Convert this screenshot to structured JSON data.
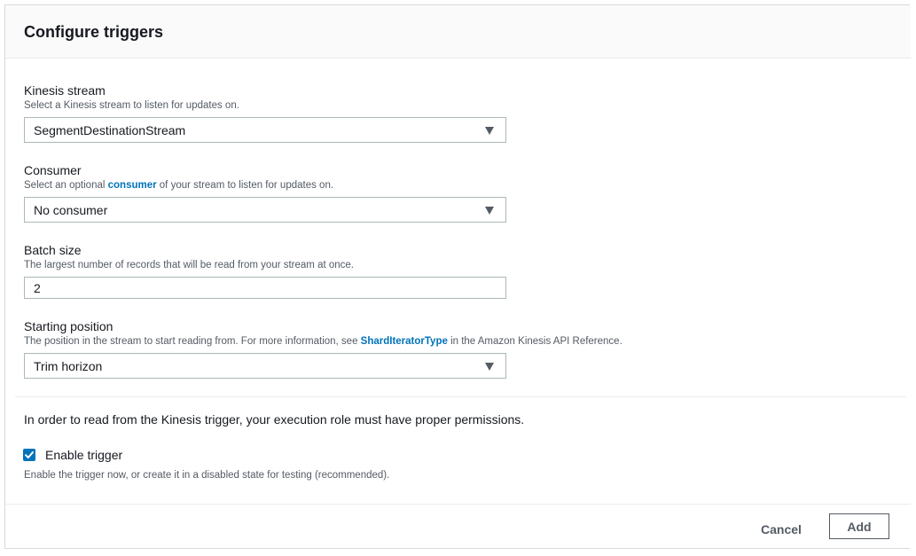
{
  "panel": {
    "title": "Configure triggers"
  },
  "kinesis_stream": {
    "label": "Kinesis stream",
    "description": "Select a Kinesis stream to listen for updates on.",
    "value": "SegmentDestinationStream",
    "icon": "chevron-down-icon"
  },
  "consumer": {
    "label": "Consumer",
    "description_before": "Select an optional ",
    "description_link": "consumer",
    "description_after": " of your stream to listen for updates on.",
    "value": "No consumer",
    "icon": "chevron-down-icon"
  },
  "batch_size": {
    "label": "Batch size",
    "description": "The largest number of records that will be read from your stream at once.",
    "value": "2"
  },
  "starting_position": {
    "label": "Starting position",
    "description_before": "The position in the stream to start reading from. For more information, see ",
    "description_link": "ShardIteratorType",
    "description_after": " in the Amazon Kinesis API Reference.",
    "value": "Trim horizon",
    "icon": "chevron-down-icon"
  },
  "permissions": {
    "note": "In order to read from the Kinesis trigger, your execution role must have proper permissions."
  },
  "enable_trigger": {
    "label": "Enable trigger",
    "checked": true,
    "description": "Enable the trigger now, or create it in a disabled state for testing (recommended).",
    "icon": "checkmark-icon"
  },
  "footer": {
    "cancel_label": "Cancel",
    "add_label": "Add"
  },
  "colors": {
    "accent": "#0073bb",
    "text": "#16191f",
    "secondary_text": "#545b64",
    "border": "#aab7b8"
  }
}
